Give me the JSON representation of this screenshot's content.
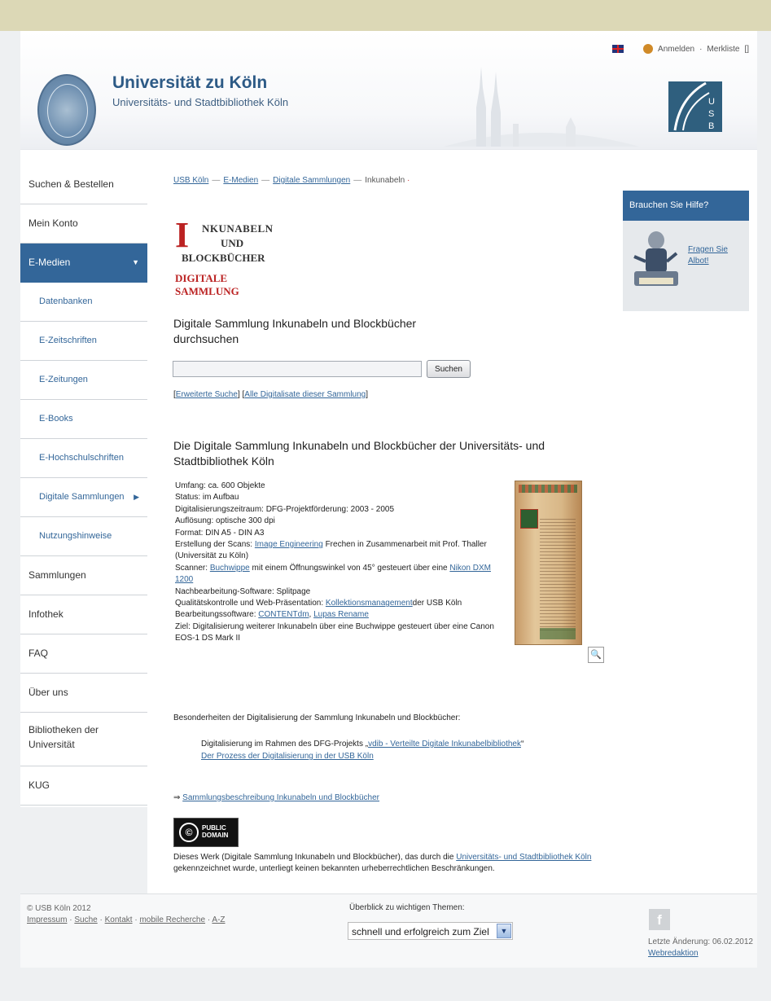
{
  "header": {
    "title": "Universität zu Köln",
    "subtitle": "Universitäts- und Stadtbibliothek Köln",
    "login_link": "Anmelden",
    "merkliste_link": "Merkliste",
    "merkliste_count": "[]"
  },
  "sidebar": {
    "items": [
      {
        "label": "Suchen & Bestellen"
      },
      {
        "label": "Mein Konto"
      },
      {
        "label": "E-Medien",
        "caret": "▼"
      },
      {
        "label": "Datenbanken"
      },
      {
        "label": "E-Zeitschriften"
      },
      {
        "label": "E-Zeitungen"
      },
      {
        "label": "E-Books"
      },
      {
        "label": "E-Hochschulschriften"
      },
      {
        "label": "Digitale Sammlungen",
        "caret": "▶"
      },
      {
        "label": "Nutzungshinweise"
      },
      {
        "label": "Sammlungen"
      },
      {
        "label": "Infothek"
      },
      {
        "label": "FAQ"
      },
      {
        "label": "Über uns"
      },
      {
        "label": "Bibliotheken der Universität"
      },
      {
        "label": "KUG"
      }
    ]
  },
  "breadcrumb": {
    "items": [
      "USB Köln",
      "E-Medien",
      "Digitale Sammlungen"
    ],
    "separator": "—",
    "current": "Inkunabeln",
    "marker": "·"
  },
  "inkunabeln_logo": {
    "initial": "I",
    "line1": "NKUNABELN",
    "line2": "UND",
    "line3": "BLOCKBÜCHER",
    "line4": "DIGITALE SAMMLUNG"
  },
  "search": {
    "title": "Digitale Sammlung Inkunabeln und Blockbücher durchsuchen",
    "input_value": "",
    "button_label": "Suchen",
    "link_extended": "Erweiterte Suche",
    "link_all": "Alle Digitalisate dieser Sammlung"
  },
  "description": {
    "title": "Die Digitale Sammlung Inkunabeln und Blockbücher der Universitäts- und Stadtbibliothek Köln",
    "umfang": "Umfang: ca. 600 Objekte",
    "status": "Status: im Aufbau",
    "zeitraum": "Digitalisierungszeitraum: DFG-Projektförderung: 2003 - 2005",
    "aufloesung": "Auflösung: optische 300 dpi",
    "format": "Format: DIN A5 - DIN A3",
    "scans_label": "Erstellung der Scans:",
    "scans_link": "Image Engineering",
    "scans_rest": "Frechen in Zusammenarbeit mit Prof. Thaller (Universität zu Köln)",
    "scanner_label": "Scanner:",
    "scanner_link1": "Buchwippe",
    "scanner_mid": "mit einem Öffnungswinkel von 45° gesteuert über eine",
    "scanner_link2": "Nikon DXM 1200",
    "nachbearbeitung": "Nachbearbeitung-Software: Splitpage",
    "qualitaet_label": "Qualitätskontrolle und Web-Präsentation:",
    "qualitaet_link": "Kollektionsmanagement",
    "qualitaet_rest": "der USB Köln",
    "software_label": "Bearbeitungssoftware:",
    "software_link1": "CONTENTdm",
    "software_sep": ",",
    "software_link2": "Lupas Rename",
    "ziel": "Ziel: Digitalisierung weiterer Inkunabeln über eine Buchwippe gesteuert über eine Canon EOS-1 DS Mark II",
    "zoom_icon": "🔍"
  },
  "besonderheiten": {
    "heading": "Besonderheiten der Digitalisierung der Sammlung Inkunabeln und Blockbücher:",
    "item1_prefix": "Digitalisierung im Rahmen des DFG-Projekts „",
    "item1_link": "vdib - Verteilte Digitale Inkunabelbibliothek",
    "item1_suffix": "“",
    "item2_link": "Der Prozess der Digitalisierung in der USB Köln"
  },
  "sammlungsbeschreibung": {
    "arrow": "⇒",
    "link": "Sammlungsbeschreibung Inkunabeln und Blockbücher"
  },
  "license": {
    "badge_line1": "PUBLIC",
    "badge_line2": "DOMAIN",
    "text_prefix": "Dieses Werk (Digitale Sammlung Inkunabeln und Blockbücher), das durch die",
    "link": "Universitäts- und Stadtbibliothek Köln",
    "text_suffix": "gekennzeichnet wurde, unterliegt keinen bekannten urheberrechtlichen Beschränkungen."
  },
  "help_box": {
    "title": "Brauchen Sie Hilfe?",
    "link": "Fragen Sie Albot!"
  },
  "footer": {
    "copyright": "© USB Köln 2012",
    "links": [
      "Impressum",
      "Suche",
      "Kontakt",
      "mobile Recherche",
      "A-Z"
    ],
    "separator": "·",
    "themes_label": "Überblick zu wichtigen Themen:",
    "themes_selected": "schnell und erfolgreich zum Ziel",
    "facebook_icon": "f",
    "last_change": "Letzte Änderung: 06.02.2012",
    "webredaktion": "Webredaktion"
  }
}
